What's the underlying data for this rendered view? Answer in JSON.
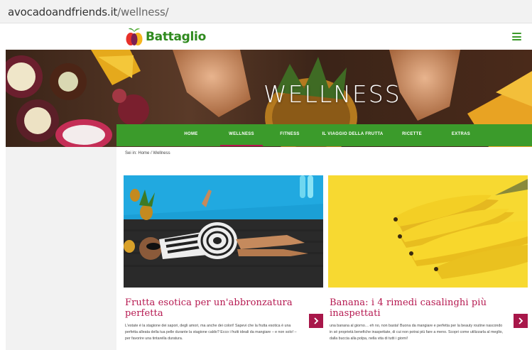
{
  "browser": {
    "url_domain": "avocadoandfriends.it",
    "url_path": "/wellness/"
  },
  "header": {
    "brand": "Battaglio",
    "menu_icon": "hamburger-menu-icon"
  },
  "hero": {
    "title": "WELLNESS"
  },
  "nav": {
    "items": [
      {
        "label": "HOME"
      },
      {
        "label": "WELLNESS"
      },
      {
        "label": "FITNESS"
      },
      {
        "label": "IL VIAGGIO DELLA FRUTTA"
      },
      {
        "label": "RICETTE"
      },
      {
        "label": "EXTRAS"
      }
    ],
    "active": "WELLNESS"
  },
  "breadcrumb": {
    "prefix": "Sei in:",
    "home": "Home",
    "separator": "/",
    "current": "Wellness"
  },
  "articles": [
    {
      "title": "Frutta esotica per un'abbronzatura perfetta",
      "excerpt": "L'estate è la stagione dei sapori, degli amori, ma anche dei colori! Sapevi che la frutta esotica è una perfetta alleata della tua pelle durante la stagione caldo? Ecco i frutti ideali da mangiare – e non solo! – per favorire una tintarella duratura.",
      "image_icon": "woman-sunbathing-poolside-image"
    },
    {
      "title": "Banana: i 4 rimedi casalinghi più inaspettati",
      "excerpt": "una banana al giorno… eh no, non basta! Buona da mangiare e perfetta per la beauty routine nascondo in sé proprietà benefiche inaspettate, di cui non potrai più fare a meno. Scopri come utilizzarla al meglio, dalla buccia alla polpa, nella vita di tutti i giorni!",
      "image_icon": "bananas-yellow-background-image"
    }
  ],
  "colors": {
    "brand_green": "#3b9b2b",
    "accent_magenta": "#b5174f",
    "banana_yellow": "#f7d931"
  }
}
